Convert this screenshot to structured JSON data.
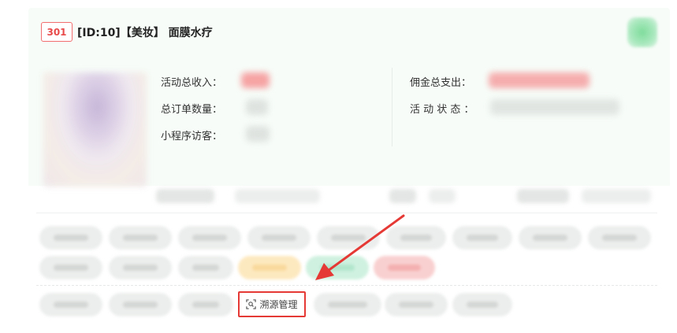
{
  "header": {
    "status_code": "301",
    "title": "[ID:10]【美妆】 面膜水疗"
  },
  "stats": {
    "total_income_label": "活动总收入：",
    "total_orders_label": "总订单数量：",
    "mini_program_visitors_label": "小程序访客：",
    "commission_label": "佣金总支出：",
    "activity_status_label": "活 动 状 态 ："
  },
  "actions": {
    "trace_label": "溯源管理"
  },
  "colors": {
    "badge": "#e84a4a",
    "highlight_box": "#e53935",
    "arrow": "#e53935",
    "income_blur": "#f7a8a8",
    "commission_blur": "#f5b0b0",
    "tag_yellow": "#fde7b8",
    "tag_green": "#c6efdc",
    "tag_red": "#f8c3c3"
  }
}
